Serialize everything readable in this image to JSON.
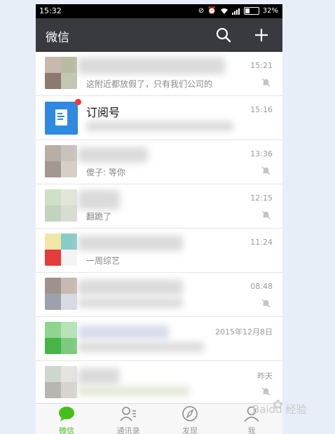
{
  "status_bar": {
    "time": "15:32",
    "battery": "32%",
    "icons": [
      "data-saver-icon",
      "alarm-icon",
      "wifi-icon",
      "signal-icon",
      "battery-icon"
    ]
  },
  "header": {
    "title": "微信",
    "search_icon": "search-icon",
    "add_icon": "plus-icon"
  },
  "chats": [
    {
      "name": "",
      "preview": "这附近都放假了，只有我们公司的",
      "time": "15:21",
      "muted": true
    },
    {
      "name": "订阅号",
      "preview": "",
      "time": "15:16",
      "muted": false,
      "badge": true
    },
    {
      "name": "",
      "preview": "傻子: 等你",
      "time": "13:36",
      "muted": true
    },
    {
      "name": "",
      "preview": "翻跪了",
      "time": "12:15",
      "muted": true
    },
    {
      "name": "",
      "preview": "一周综艺",
      "time": "11:24",
      "muted": false
    },
    {
      "name": "",
      "preview": "",
      "time": "08:48",
      "muted": true
    },
    {
      "name": "",
      "preview": "",
      "time": "2015年12月8日",
      "muted": false
    },
    {
      "name": "",
      "preview": "",
      "time": "昨天",
      "muted": true
    }
  ],
  "tabs": [
    {
      "label": "微信",
      "icon": "chat-bubble-icon",
      "active": true
    },
    {
      "label": "通讯录",
      "icon": "contacts-icon",
      "active": false
    },
    {
      "label": "发现",
      "icon": "compass-icon",
      "active": false
    },
    {
      "label": "我",
      "icon": "person-icon",
      "active": false
    }
  ],
  "watermark": {
    "text": "Baidu 经验"
  },
  "colors": {
    "app_bar": "#393a3f",
    "accent": "#45c01a",
    "badge": "#f43530",
    "subscription": "#2f89e0"
  }
}
